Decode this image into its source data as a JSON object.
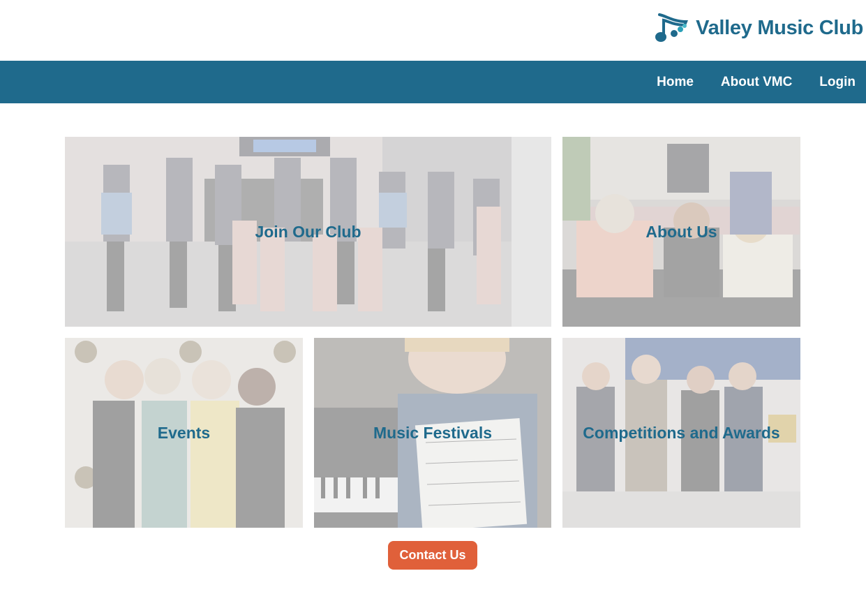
{
  "brand": {
    "name": "Valley Music Club",
    "logo_icon": "music-note-logo-icon"
  },
  "nav": {
    "items": [
      {
        "label": "Home"
      },
      {
        "label": "About VMC"
      },
      {
        "label": "Login"
      }
    ]
  },
  "tiles": [
    {
      "label": "Join Our Club",
      "photo": "group of children at a recital"
    },
    {
      "label": "About Us",
      "photo": "club members seated at a table"
    },
    {
      "label": "Events",
      "photo": "members at a National Federation of Music Clubs backdrop"
    },
    {
      "label": "Music Festivals",
      "photo": "student holding sheet music by a piano"
    },
    {
      "label": "Competitions and Awards",
      "photo": "award recipients at Mount Aloysius"
    }
  ],
  "contact": {
    "label": "Contact Us"
  },
  "colors": {
    "brand_blue": "#1f6a8c",
    "accent_orange": "#e0603a",
    "nav_text": "#ffffff"
  }
}
